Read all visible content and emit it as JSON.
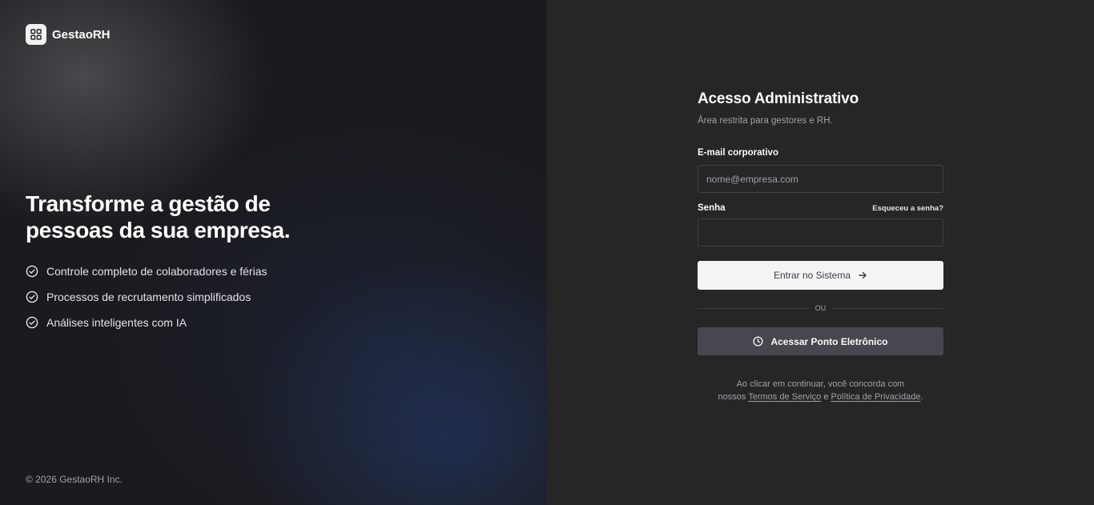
{
  "brand": {
    "name": "GestaoRH",
    "logo_icon": "layout-grid-icon"
  },
  "hero": {
    "title_line1": "Transforme a gestão de",
    "title_line2": "pessoas da sua empresa.",
    "features": [
      {
        "icon": "check-circle-icon",
        "label": "Controle completo de colaboradores e férias"
      },
      {
        "icon": "check-circle-icon",
        "label": "Processos de recrutamento simplificados"
      },
      {
        "icon": "check-circle-icon",
        "label": "Análises inteligentes com IA"
      }
    ]
  },
  "footer": {
    "copyright": "© 2026 GestaoRH Inc."
  },
  "login": {
    "title": "Acesso Administrativo",
    "subtitle": "Área restrita para gestores e RH.",
    "email_label": "E-mail corporativo",
    "email_placeholder": "nome@empresa.com",
    "email_value": "",
    "password_label": "Senha",
    "password_value": "",
    "forgot_link": "Esqueceu a senha?",
    "submit_label": "Entrar no Sistema",
    "submit_icon": "arrow-right-icon",
    "divider_text": "OU",
    "time_clock_label": "Acessar Ponto Eletrônico",
    "time_clock_icon": "clock-icon"
  },
  "terms": {
    "line1": "Ao clicar em continuar, você concorda com",
    "prefix": "nossos",
    "terms_link": "Termos de Serviço",
    "conjunction": "e",
    "privacy_link": "Política de Privacidade",
    "suffix": "."
  },
  "colors": {
    "left_background": "#1b1b1f",
    "right_background": "#262626",
    "primary_button": "#f4f4f5",
    "secondary_button": "#48474f",
    "input_border": "#424246",
    "muted_text": "#a1a1aa"
  }
}
